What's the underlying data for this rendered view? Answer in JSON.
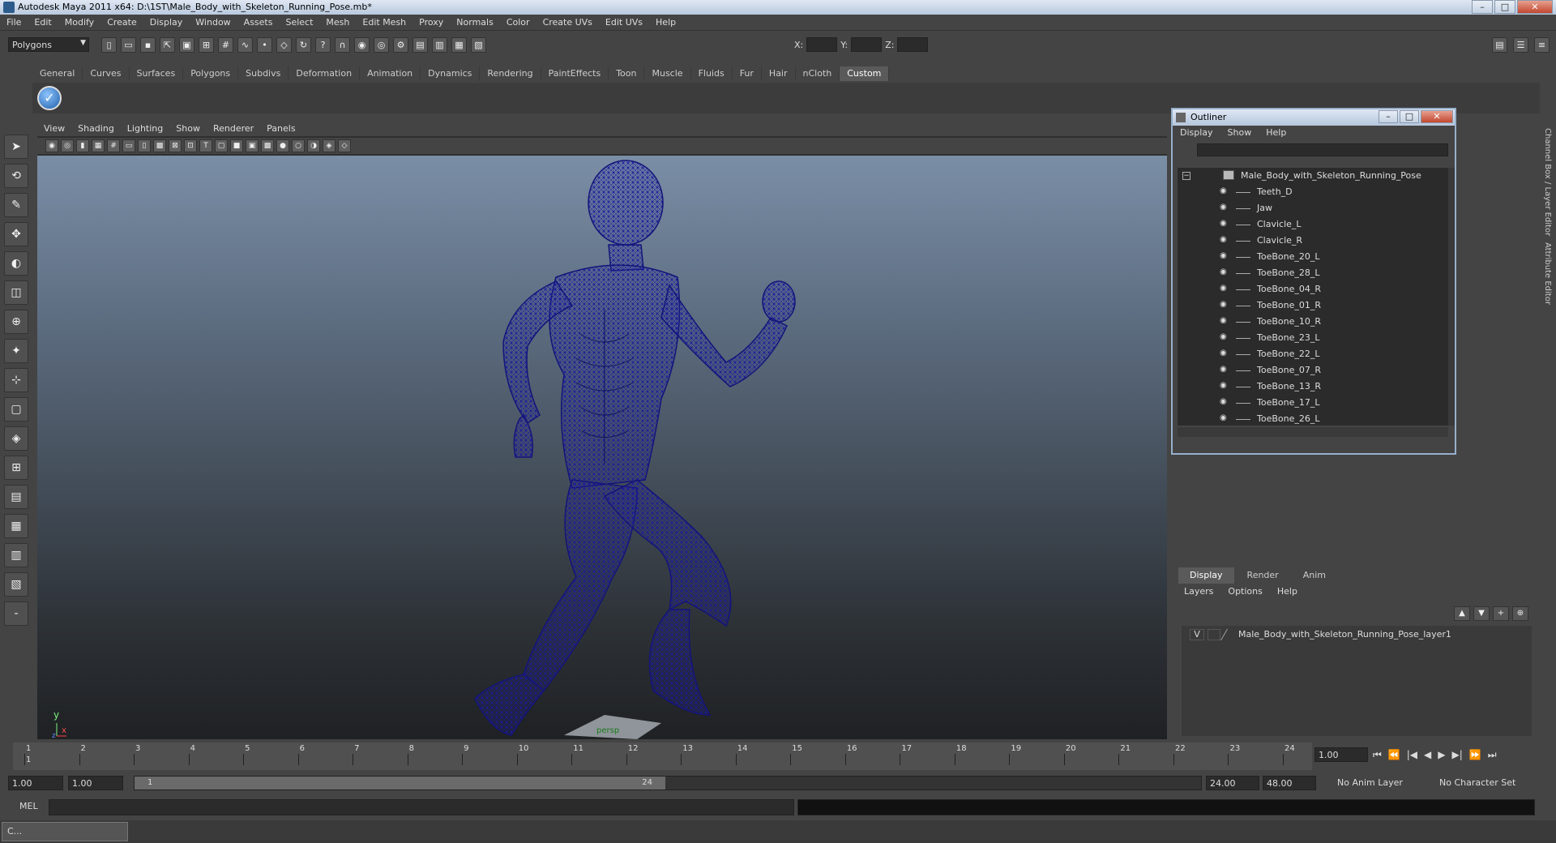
{
  "window": {
    "title": "Autodesk Maya 2011 x64: D:\\1ST\\Male_Body_with_Skeleton_Running_Pose.mb*",
    "minimize": "–",
    "maximize": "□",
    "close": "✕"
  },
  "menubar": [
    "File",
    "Edit",
    "Modify",
    "Create",
    "Display",
    "Window",
    "Assets",
    "Select",
    "Mesh",
    "Edit Mesh",
    "Proxy",
    "Normals",
    "Color",
    "Create UVs",
    "Edit UVs",
    "Help"
  ],
  "statusline": {
    "mode": "Polygons",
    "x_label": "X:",
    "y_label": "Y:",
    "z_label": "Z:"
  },
  "shelf": {
    "tabs": [
      "General",
      "Curves",
      "Surfaces",
      "Polygons",
      "Subdivs",
      "Deformation",
      "Animation",
      "Dynamics",
      "Rendering",
      "PaintEffects",
      "Toon",
      "Muscle",
      "Fluids",
      "Fur",
      "Hair",
      "nCloth",
      "Custom"
    ],
    "active_tab": "Custom"
  },
  "viewport": {
    "menu": [
      "View",
      "Shading",
      "Lighting",
      "Show",
      "Renderer",
      "Panels"
    ],
    "axis_y": "y",
    "axis_x": "x",
    "axis_z": "z",
    "grid_label": "persp"
  },
  "outliner": {
    "title": "Outliner",
    "menu": [
      "Display",
      "Show",
      "Help"
    ],
    "root": "Male_Body_with_Skeleton_Running_Pose",
    "items": [
      "Teeth_D",
      "Jaw",
      "Clavicle_L",
      "Clavicle_R",
      "ToeBone_20_L",
      "ToeBone_28_L",
      "ToeBone_04_R",
      "ToeBone_01_R",
      "ToeBone_10_R",
      "ToeBone_23_L",
      "ToeBone_22_L",
      "ToeBone_07_R",
      "ToeBone_13_R",
      "ToeBone_17_L",
      "ToeBone_26_L"
    ]
  },
  "channel_tabs": [
    "Channel Box / Layer Editor",
    "Attribute Editor"
  ],
  "layers": {
    "tabs": [
      "Display",
      "Render",
      "Anim"
    ],
    "active_tab": "Display",
    "menu": [
      "Layers",
      "Options",
      "Help"
    ],
    "rows": [
      {
        "visible": "V",
        "name": "Male_Body_with_Skeleton_Running_Pose_layer1"
      }
    ]
  },
  "timeline": {
    "ticks": [
      "1",
      "2",
      "3",
      "4",
      "5",
      "6",
      "7",
      "8",
      "9",
      "10",
      "11",
      "12",
      "13",
      "14",
      "15",
      "16",
      "17",
      "18",
      "19",
      "20",
      "21",
      "22",
      "23",
      "24"
    ],
    "current_frame_marker": "1",
    "current_frame": "1.00"
  },
  "range": {
    "start": "1.00",
    "playback_start": "1.00",
    "handle_start": "1",
    "handle_end": "24",
    "playback_end": "24.00",
    "end": "48.00",
    "anim_layer": "No Anim Layer",
    "character_set": "No Character Set"
  },
  "cmdline": {
    "label": "MEL"
  },
  "taskbar": {
    "item": "C..."
  }
}
